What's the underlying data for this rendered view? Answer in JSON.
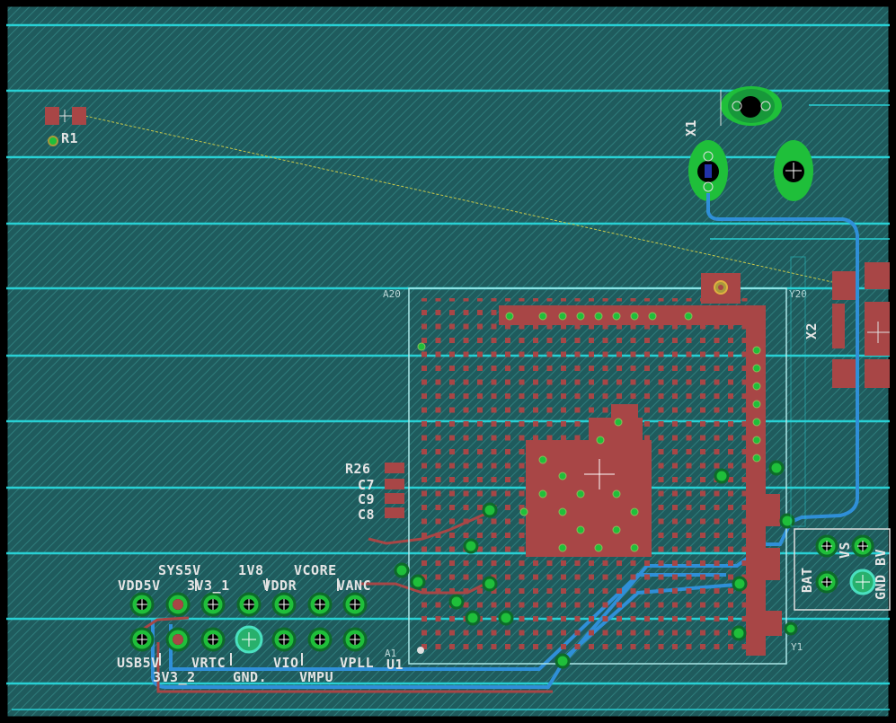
{
  "colors": {
    "background": "#1e5a5c",
    "hatch": "#2e7a7a",
    "frame": "#000000",
    "cyan_line": "#28d0d4",
    "copper_top": "#a84646",
    "copper_bottom": "#2f8fd8",
    "pad_green": "#1fbf3a",
    "silk": "#e0e0e0",
    "airwire": "#c8c84a"
  },
  "components": {
    "r1": "R1",
    "x1": "X1",
    "x2": "X2",
    "a20": "A20",
    "y20": "Y20",
    "r26": "R26",
    "c7": "C7",
    "c9": "C9",
    "c8": "C8",
    "a1": "A1",
    "u1": "U1",
    "y1": "Y1",
    "bat": "BAT",
    "vs": "VS",
    "gnd_bv": "GND BV"
  },
  "header_labels": {
    "top_row1": [
      "SYS5V",
      "1V8",
      "VCORE"
    ],
    "top_row2": [
      "VDD5V",
      "3V3_1",
      "VDDR",
      "VANC"
    ],
    "bottom_row1": [
      "USB5V",
      "VRTC",
      "VIO",
      "VPLL"
    ],
    "bottom_row2": [
      "3V3_2",
      "GND.",
      "VMPU"
    ]
  },
  "icons": {
    "origin_cross": "crosshair-icon",
    "via": "via-icon",
    "pad": "pad-icon"
  }
}
